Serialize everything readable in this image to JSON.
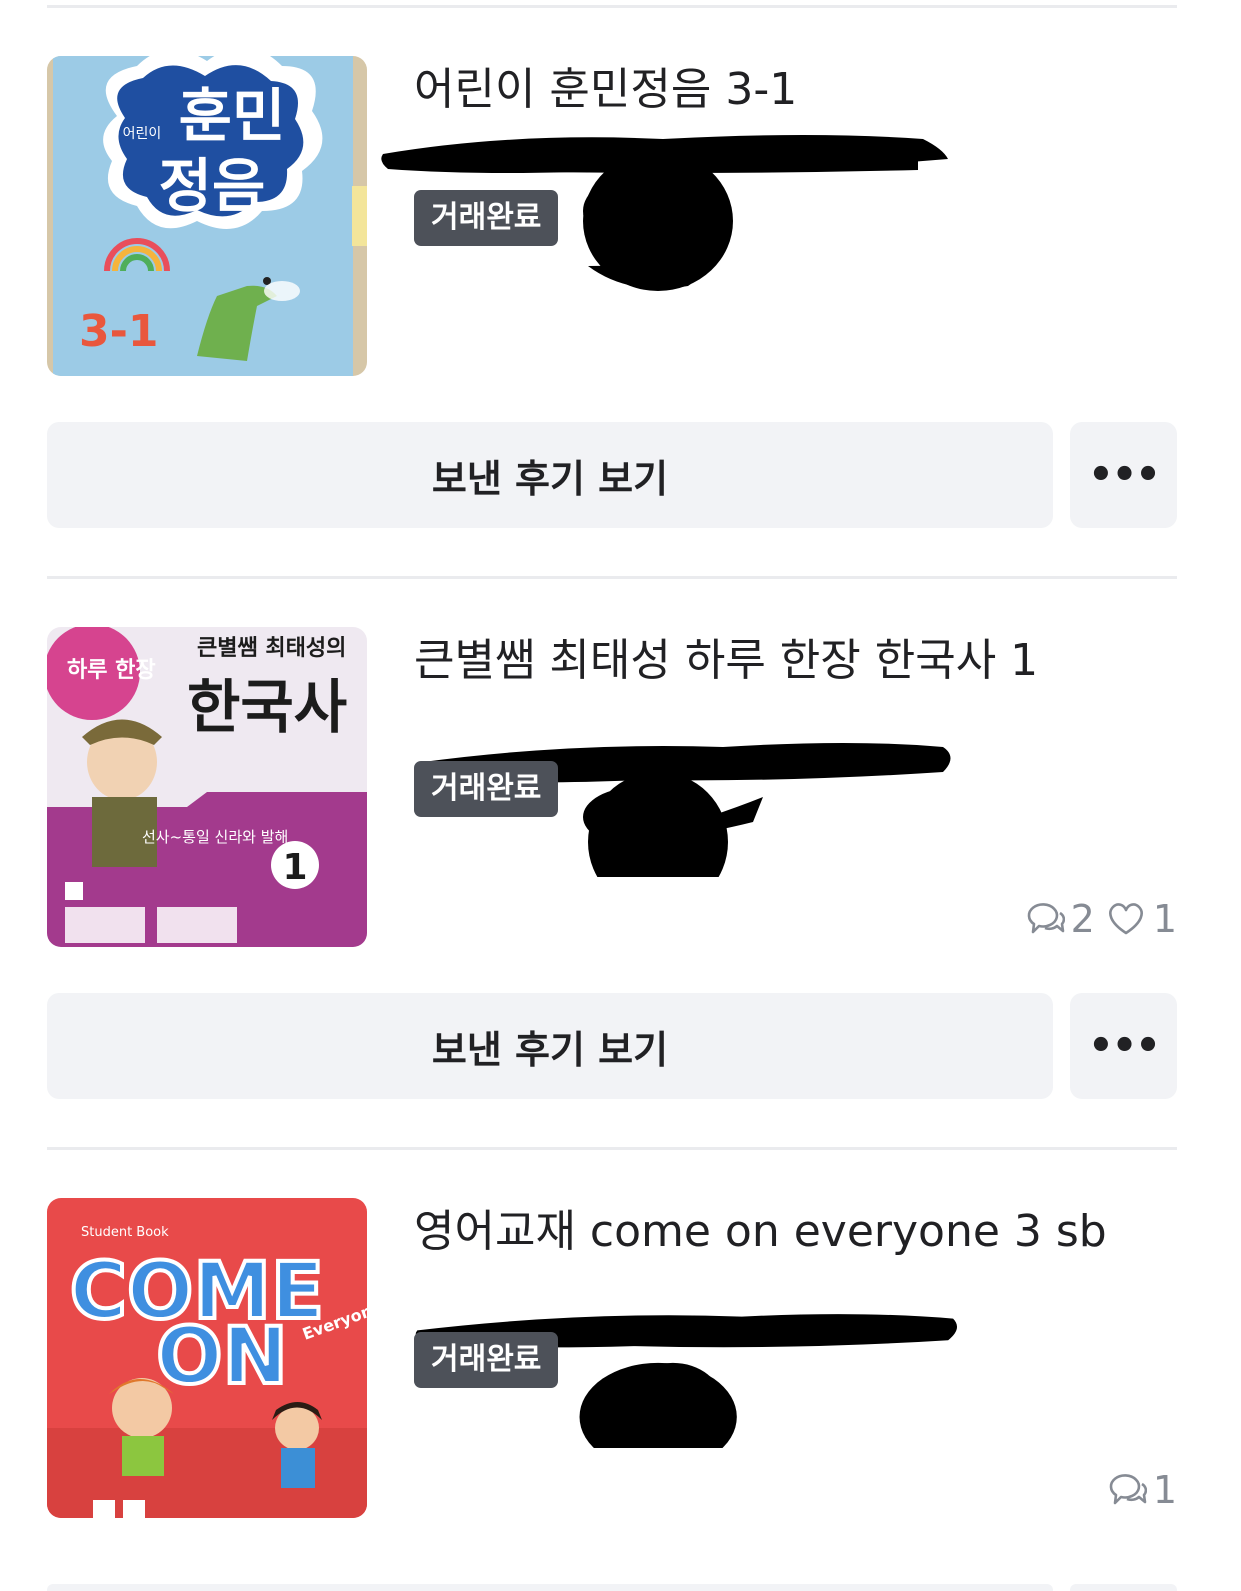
{
  "items": [
    {
      "title": "어린이 훈민정음 3-1",
      "status": "거래완료",
      "review_label": "보낸 후기 보기",
      "more_label": "•••",
      "cover_text": {
        "line1": "훈민",
        "line2": "정음",
        "prefix": "어린이",
        "grade": "3-1"
      }
    },
    {
      "title": "큰별쌤 최태성 하루 한장 한국사 1",
      "status": "거래완료",
      "review_label": "보낸 후기 보기",
      "more_label": "•••",
      "chat_count": "2",
      "like_count": "1",
      "cover_text": {
        "top": "큰별쌤 최태성의",
        "side": "하루 한장",
        "main": "한국사",
        "sub": "선사~통일 신라와 발해",
        "vol": "1"
      }
    },
    {
      "title": "영어교재 come on everyone 3 sb",
      "status": "거래완료",
      "chat_count": "1",
      "cover_text": {
        "line1": "COME",
        "line2": "ON",
        "tag": "Everyone",
        "corner": "Student Book"
      }
    }
  ],
  "colors": {
    "badge": "#4d5159",
    "button_bg": "#f2f3f6",
    "divider": "#eaebee",
    "meta": "#868b94"
  },
  "icons": [
    "chat-bubble-icon",
    "heart-icon",
    "more-icon"
  ]
}
